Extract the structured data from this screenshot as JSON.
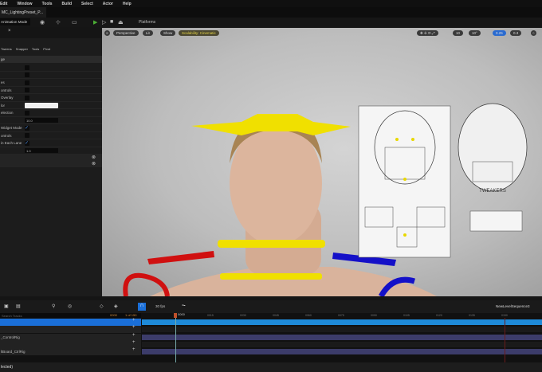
{
  "menu": [
    "Edit",
    "Window",
    "Tools",
    "Build",
    "Select",
    "Actor",
    "Help"
  ],
  "tab": {
    "label": "MC_LightingPreset_P..."
  },
  "toolbar": {
    "mode": "Animation Mode",
    "platforms": "Platforms"
  },
  "left_panel": {
    "tools": [
      "Tweens",
      "Snapper",
      "Tools",
      "Pivot"
    ],
    "section": "ge",
    "rows": [
      {
        "label": "",
        "type": "check",
        "checked": false
      },
      {
        "label": "",
        "type": "check",
        "checked": false
      },
      {
        "label": "es",
        "type": "check",
        "checked": false
      },
      {
        "label": "ontrols",
        "type": "check",
        "checked": false
      },
      {
        "label": "Overlay",
        "type": "check",
        "checked": false
      },
      {
        "label": "lor",
        "type": "color",
        "value": "#f0f0f0"
      },
      {
        "label": "election",
        "type": "check",
        "checked": false
      },
      {
        "label": "",
        "type": "number",
        "value": "10.0"
      },
      {
        "label": "Widget Mode",
        "type": "check",
        "checked": true
      },
      {
        "label": "ontrols",
        "type": "check",
        "checked": false
      },
      {
        "label": "in Each Lane",
        "type": "check",
        "checked": true
      },
      {
        "label": "",
        "type": "number",
        "value": "1.0"
      }
    ]
  },
  "viewport": {
    "pills": [
      "Perspective",
      "Lit",
      "Show",
      "Scalability: Cinematic"
    ],
    "right_values": [
      "10",
      "10°",
      "0.25",
      "0.3"
    ],
    "sheet_label": "TWEAKERS",
    "accent": "#f0e000"
  },
  "sequencer": {
    "fps": "30 fps",
    "search_placeholder": "Search Tracks",
    "frame": "0000",
    "frame_count": "1 of 150",
    "playhead": "0000",
    "sequence_name": "NewLevelSequence3",
    "ticks": [
      "0015",
      "0030",
      "0045",
      "0060",
      "0075",
      "0090",
      "0105",
      "0120",
      "0135",
      "0150"
    ],
    "tracks": [
      "",
      "",
      "_ControlRig",
      "",
      "ltBoard_CtrlRig"
    ]
  },
  "status": "lected)"
}
